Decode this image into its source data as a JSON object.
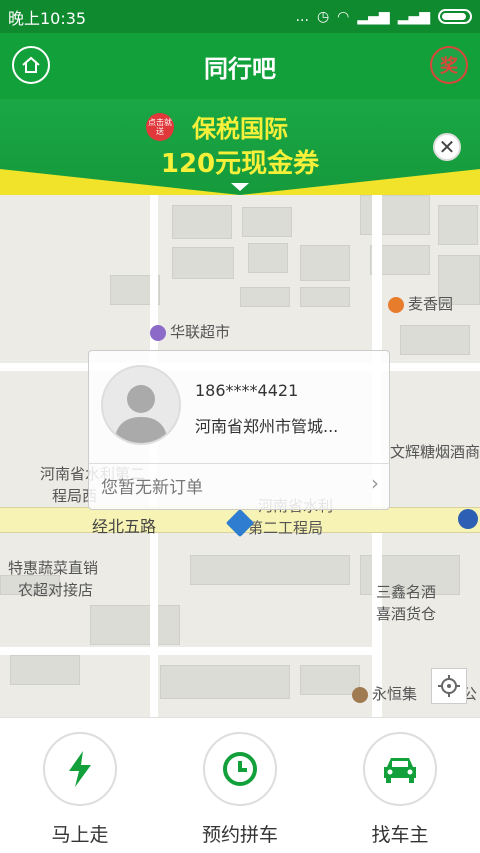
{
  "status": {
    "time": "晚上10:35",
    "dots": "...",
    "colors": {
      "bar": "#0f8a2f"
    }
  },
  "header": {
    "title": "同行吧",
    "prize_label": "奖",
    "colors": {
      "bar": "#12a03b",
      "prize": "#d8483a"
    }
  },
  "banner": {
    "badge": "点击就送",
    "line1": "保税国际",
    "line2": "120元现金券",
    "close": "✕",
    "colors": {
      "text": "#f7f03a",
      "accent": "#f0e32a"
    }
  },
  "map": {
    "pois": [
      "华联超市",
      "麦香园",
      "文辉糖烟酒商",
      "河南省水利第二",
      "程局西",
      "经北五路",
      "河南省水利",
      "第二工程局",
      "特惠蔬菜直销",
      "农超对接店",
      "三鑫名酒",
      "喜酒货仓",
      "永恒集",
      "公"
    ]
  },
  "popup": {
    "phone": "186****4421",
    "address": "河南省郑州市管城...",
    "no_order": "您暂无新订单",
    "chevron": "›"
  },
  "tabs": [
    {
      "label": "马上走",
      "icon": "lightning-icon"
    },
    {
      "label": "预约拼车",
      "icon": "clock-icon"
    },
    {
      "label": "找车主",
      "icon": "car-icon"
    }
  ],
  "colors": {
    "accent_green": "#12a03b"
  }
}
